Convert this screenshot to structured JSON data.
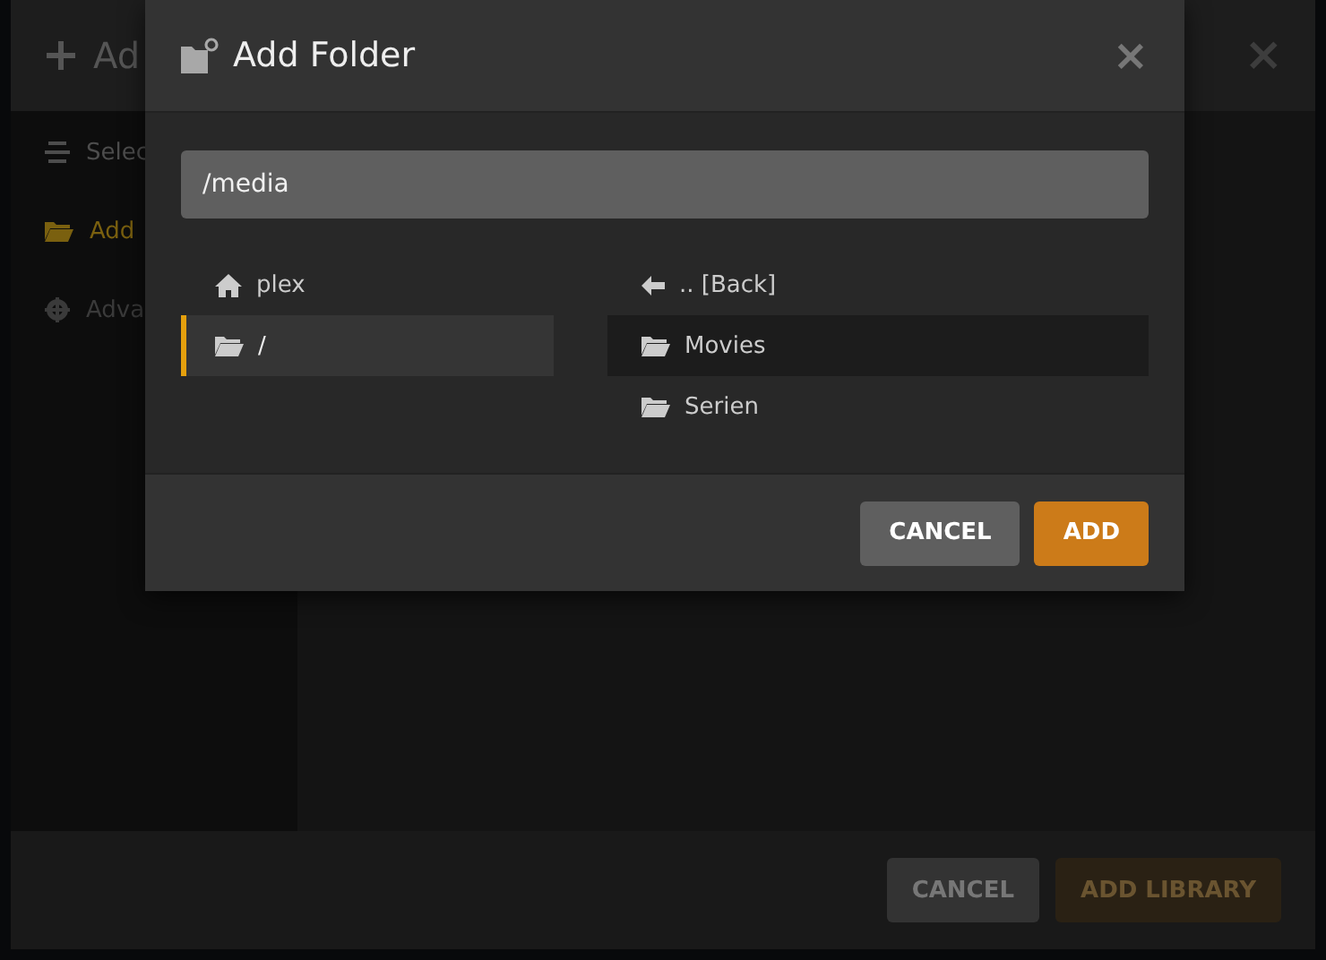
{
  "background_dialog": {
    "title": "Ad",
    "close": "×",
    "sidebar": {
      "items": [
        {
          "label": "Selec",
          "selected": false,
          "disabled": false
        },
        {
          "label": "Add",
          "selected": true,
          "disabled": false
        },
        {
          "label": "Adva",
          "selected": false,
          "disabled": true
        }
      ]
    },
    "buttons": [
      {
        "label": "CANCEL",
        "kind": "secondary",
        "disabled": false
      },
      {
        "label": "ADD LIBRARY",
        "kind": "primary",
        "disabled": true
      }
    ]
  },
  "modal": {
    "title": "Add Folder",
    "close": "×",
    "path_field": {
      "value": "/media"
    },
    "locations": [
      {
        "label": "plex",
        "selected": false
      },
      {
        "label": "/",
        "selected": true
      }
    ],
    "folders": [
      {
        "label": ".. [Back]",
        "selected": false
      },
      {
        "label": "Movies",
        "selected": true
      },
      {
        "label": "Serien",
        "selected": false
      }
    ],
    "buttons": [
      {
        "label": "CANCEL",
        "kind": "secondary"
      },
      {
        "label": "ADD",
        "kind": "primary"
      }
    ]
  }
}
